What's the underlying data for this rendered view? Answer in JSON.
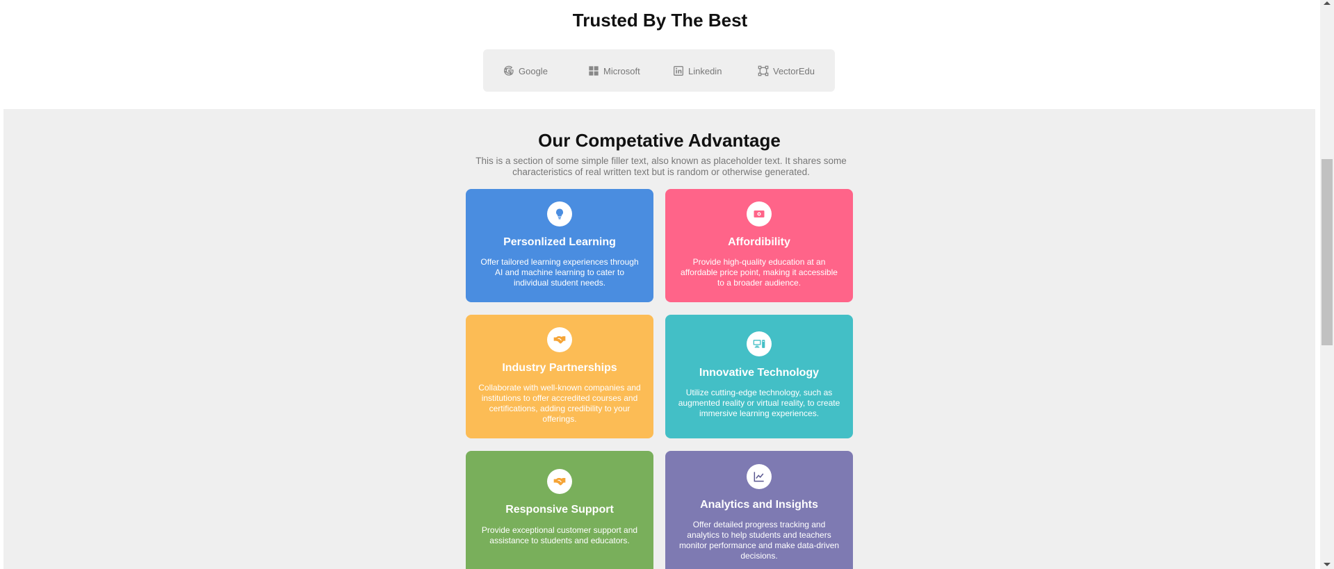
{
  "trusted": {
    "title": "Trusted By The Best",
    "logos": [
      {
        "label": "Google",
        "icon": "google-icon"
      },
      {
        "label": "Microsoft",
        "icon": "microsoft-icon"
      },
      {
        "label": "Linkedin",
        "icon": "linkedin-icon"
      },
      {
        "label": "VectorEdu",
        "icon": "vector-icon"
      }
    ]
  },
  "advantage": {
    "title": "Our Competative Advantage",
    "subtitle": "This is a section of some simple filler text, also known as placeholder text. It shares some characteristics of real written text but is random or otherwise generated.",
    "cards": [
      {
        "title": "Personlized Learning",
        "text": "Offer tailored learning experiences through AI and machine learning to cater to individual student needs.",
        "icon": "lightbulb-icon",
        "color": "#4a8de0",
        "icon_color": "#4a8de0"
      },
      {
        "title": "Affordibility",
        "text": "Provide high-quality education at an affordable price point, making it accessible to a broader audience.",
        "icon": "money-icon",
        "color": "#ff6489",
        "icon_color": "#ff6489"
      },
      {
        "title": "Industry Partnerships",
        "text": "Collaborate with well-known companies and institutions to offer accredited courses and certifications, adding credibility to your offerings.",
        "icon": "handshake-icon",
        "color": "#fcbc55",
        "icon_color": "#f5a436"
      },
      {
        "title": "Innovative Technology",
        "text": "Utilize cutting-edge technology, such as augmented reality or virtual reality, to create immersive learning experiences.",
        "icon": "computer-icon",
        "color": "#43bfc6",
        "icon_color": "#43bfc6"
      },
      {
        "title": "Responsive Support",
        "text": "Provide exceptional customer support and assistance to students and educators.",
        "icon": "handshake-icon",
        "color": "#79af5b",
        "icon_color": "#f5a436"
      },
      {
        "title": "Analytics and Insights",
        "text": "Offer detailed progress tracking and analytics to help students and teachers monitor performance and make data-driven decisions.",
        "icon": "chart-line-icon",
        "color": "#7e7ab2",
        "icon_color": "#5a5790"
      }
    ]
  }
}
